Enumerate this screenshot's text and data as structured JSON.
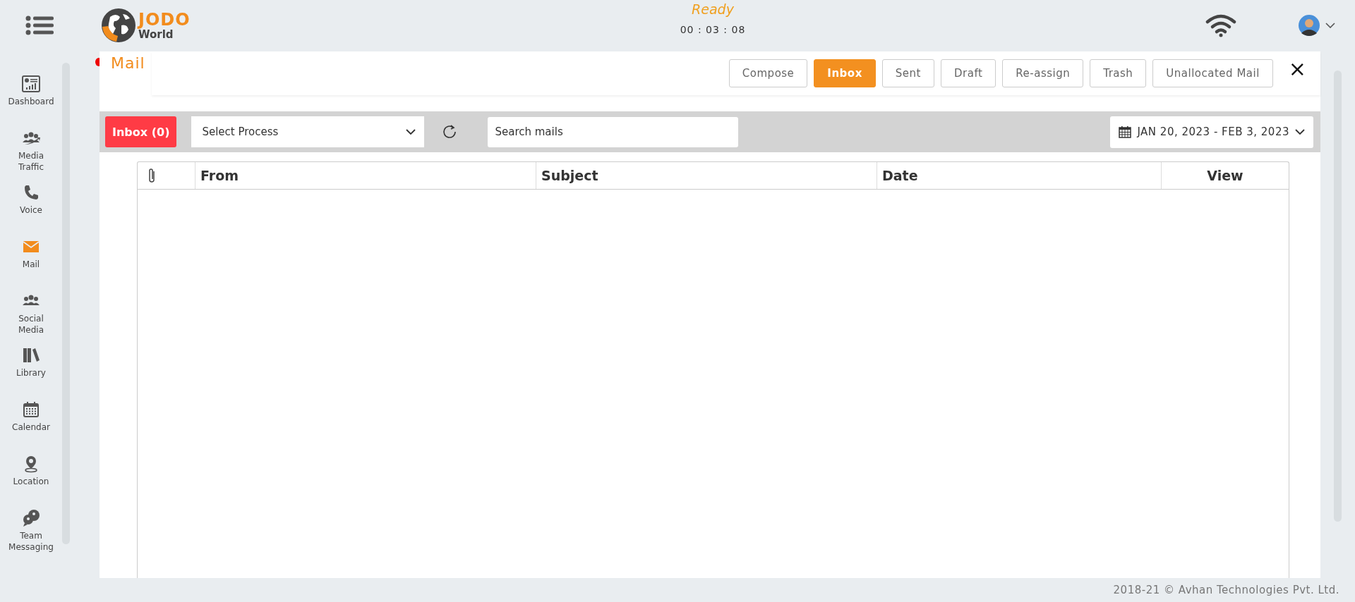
{
  "header": {
    "logo_title": "JODO",
    "logo_subtitle": "World",
    "status": "Ready",
    "timer": "00 : 03 : 08"
  },
  "sidebar": {
    "items": [
      {
        "label": "Dashboard",
        "kind": "dashboard",
        "selected": false
      },
      {
        "label": "Media Traffic",
        "kind": "traffic",
        "selected": false
      },
      {
        "label": "Voice",
        "kind": "phone",
        "selected": false
      },
      {
        "label": "Mail",
        "kind": "mail",
        "selected": true
      },
      {
        "label": "Social Media",
        "kind": "people",
        "selected": false
      },
      {
        "label": "Library",
        "kind": "books",
        "selected": false
      },
      {
        "label": "Calendar",
        "kind": "calendar",
        "selected": false
      },
      {
        "label": "Location",
        "kind": "pin",
        "selected": false
      },
      {
        "label": "Team Messaging",
        "kind": "chat",
        "selected": false
      }
    ]
  },
  "panel": {
    "title": "Mail",
    "tabs": [
      {
        "label": "Compose",
        "selected": false
      },
      {
        "label": "Inbox",
        "selected": true
      },
      {
        "label": "Sent",
        "selected": false
      },
      {
        "label": "Draft",
        "selected": false
      },
      {
        "label": "Re-assign",
        "selected": false
      },
      {
        "label": "Trash",
        "selected": false
      },
      {
        "label": "Unallocated Mail",
        "selected": false
      }
    ],
    "close": "×"
  },
  "toolbar": {
    "folder_badge": "Inbox (0)",
    "process_select": {
      "placeholder": "Select Process"
    },
    "search": {
      "placeholder": "Search mails"
    },
    "date_range": "JAN 20, 2023 - FEB 3, 2023"
  },
  "table": {
    "columns": [
      {
        "kind": "attachment"
      },
      {
        "kind": "text",
        "label": "From"
      },
      {
        "kind": "text",
        "label": "Subject"
      },
      {
        "kind": "text",
        "label": "Date"
      },
      {
        "kind": "center",
        "label": "View"
      }
    ]
  },
  "footer": "2018-21 © Avhan Technologies Pvt. Ltd."
}
